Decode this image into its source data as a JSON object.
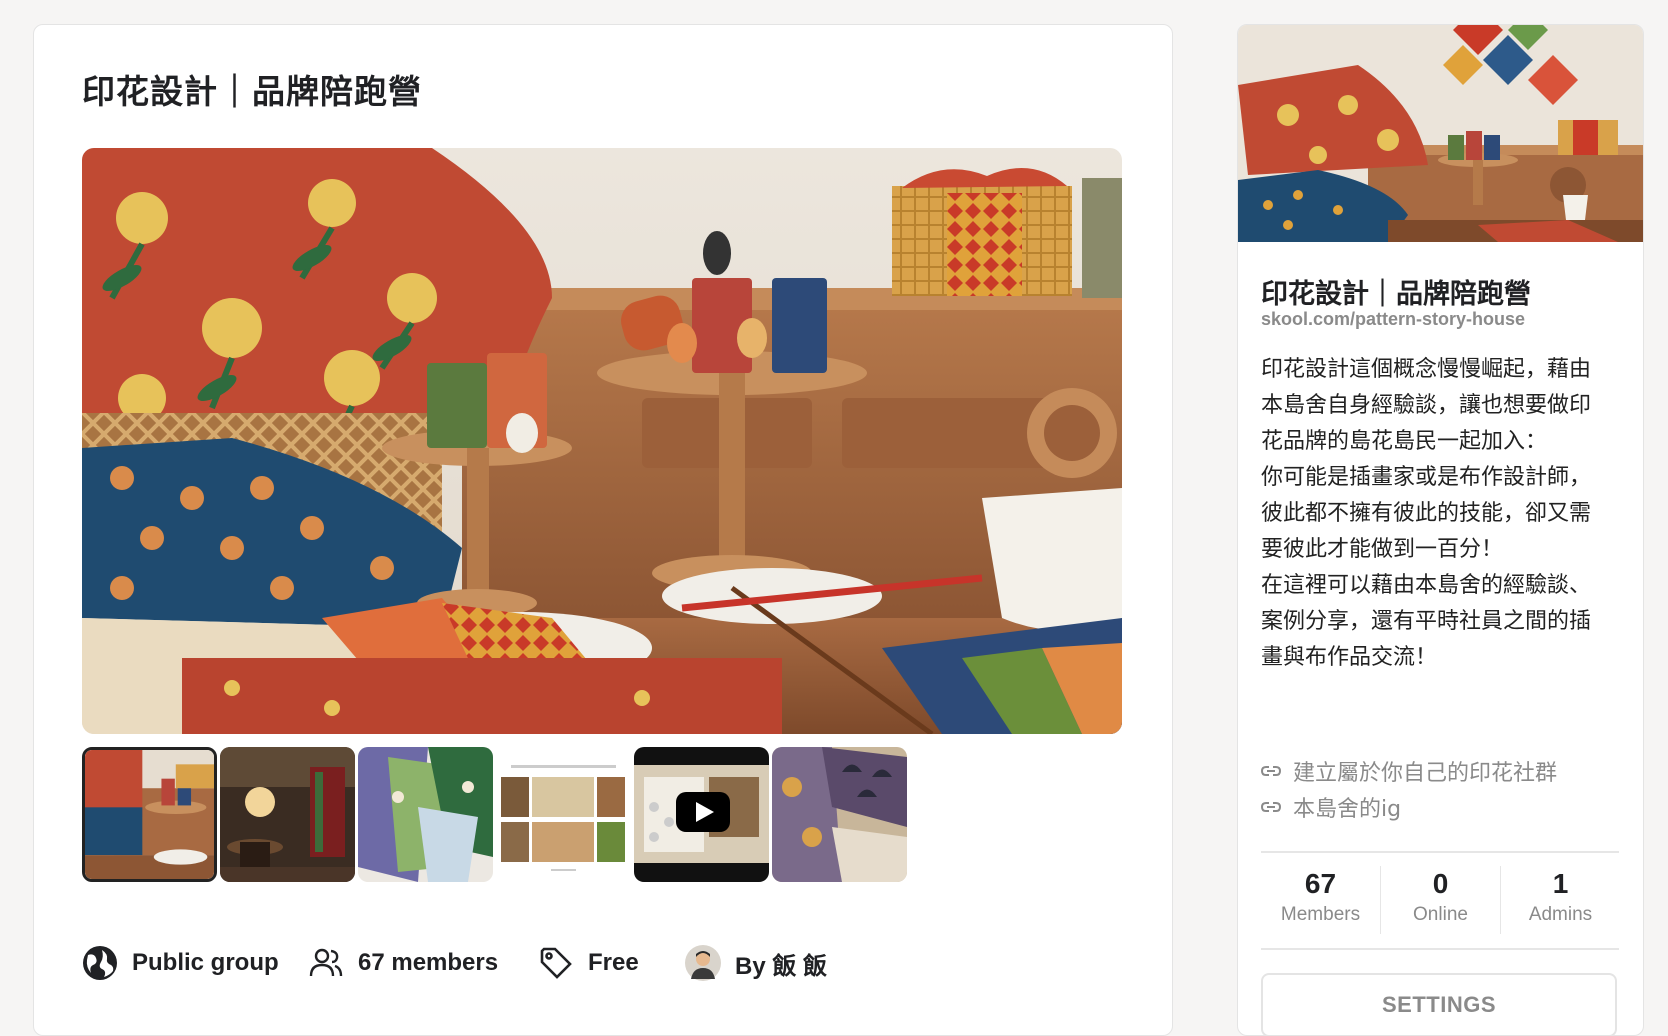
{
  "group": {
    "title": "印花設計｜品牌陪跑營",
    "hero_alt": "Printed textile products on wooden table",
    "media": [
      {
        "type": "image",
        "icon": "photo-icon",
        "selected": true
      },
      {
        "type": "image",
        "icon": "photo-icon",
        "selected": false
      },
      {
        "type": "image",
        "icon": "photo-icon",
        "selected": false
      },
      {
        "type": "image",
        "icon": "photo-icon",
        "selected": false
      },
      {
        "type": "video",
        "icon": "play-icon",
        "selected": false
      },
      {
        "type": "image",
        "icon": "photo-icon",
        "selected": false
      }
    ],
    "meta": {
      "privacy": {
        "label": "Public group",
        "icon": "globe-icon"
      },
      "members": {
        "label": "67 members",
        "icon": "users-icon"
      },
      "price": {
        "label": "Free",
        "icon": "tag-icon"
      },
      "owner": {
        "label": "By 飯 飯",
        "icon": "avatar"
      }
    }
  },
  "sidebar": {
    "title": "印花設計｜品牌陪跑營",
    "url": "skool.com/pattern-story-house",
    "description": [
      "印花設計這個概念慢慢崛起，藉由本島舍自身經驗談，讓也想要做印花品牌的島花島民一起加入：",
      "你可能是插畫家或是布作設計師，彼此都不擁有彼此的技能，卻又需要彼此才能做到一百分！",
      "在這裡可以藉由本島舍的經驗談、案例分享，還有平時社員之間的插畫與布作品交流！"
    ],
    "links": [
      {
        "label": "建立屬於你自己的印花社群",
        "icon": "link-icon"
      },
      {
        "label": "本島舍的ig",
        "icon": "link-icon"
      }
    ],
    "stats": [
      {
        "value": "67",
        "label": "Members"
      },
      {
        "value": "0",
        "label": "Online"
      },
      {
        "value": "1",
        "label": "Admins"
      }
    ],
    "settings_label": "SETTINGS"
  },
  "colors": {
    "background": "#f6f5f4",
    "card": "#ffffff",
    "text": "#202124",
    "muted": "#8a8a8a",
    "divider": "#e6e6e6"
  }
}
